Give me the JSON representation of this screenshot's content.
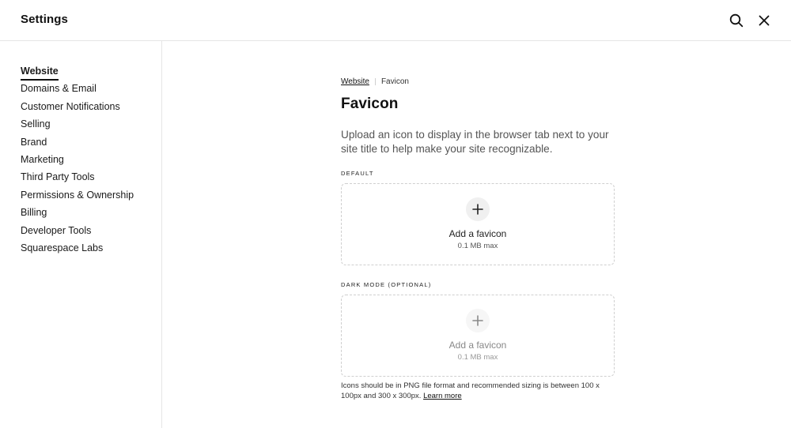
{
  "header": {
    "title": "Settings",
    "search_icon": "search-icon",
    "close_icon": "close-icon"
  },
  "sidebar": {
    "items": [
      {
        "label": "Website",
        "active": true
      },
      {
        "label": "Domains & Email"
      },
      {
        "label": "Customer Notifications"
      },
      {
        "label": "Selling"
      },
      {
        "label": "Brand"
      },
      {
        "label": "Marketing"
      },
      {
        "label": "Third Party Tools"
      },
      {
        "label": "Permissions & Ownership"
      },
      {
        "label": "Billing"
      },
      {
        "label": "Developer Tools"
      },
      {
        "label": "Squarespace Labs"
      }
    ]
  },
  "main": {
    "breadcrumb": {
      "parent": "Website",
      "current": "Favicon"
    },
    "title": "Favicon",
    "description": "Upload an icon to display in the browser tab next to your site title to help make your site recognizable.",
    "default_section": {
      "label": "DEFAULT",
      "upload_title": "Add a favicon",
      "upload_limit": "0.1 MB max",
      "icon": "plus-icon"
    },
    "dark_section": {
      "label": "DARK MODE (OPTIONAL)",
      "upload_title": "Add a favicon",
      "upload_limit": "0.1 MB max",
      "icon": "plus-icon"
    },
    "help_text": "Icons should be in PNG file format and recommended sizing is between 100 x 100px and 300 x 300px.",
    "learn_more": "Learn more"
  },
  "colors": {
    "text": "#111111",
    "muted": "#555555",
    "border": "#e6e6e6",
    "dashed_border": "#cfcfcf"
  }
}
